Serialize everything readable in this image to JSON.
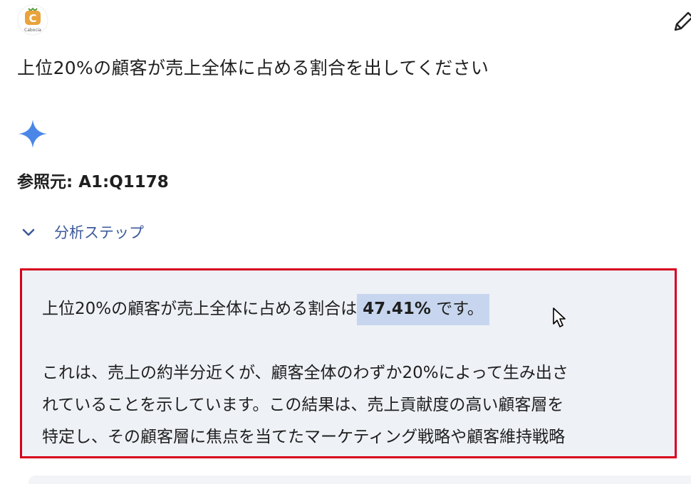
{
  "header": {
    "avatar_name": "Cabocia",
    "avatar_letter": "C",
    "avatar_icon": "cabocia-logo",
    "edit_icon": "pencil-icon"
  },
  "user_query": "上位20%の顧客が売上全体に占める割合を出してください",
  "response": {
    "icon": "sparkle-icon",
    "source_label": "参照元: A1:Q1178",
    "steps_label": "分析ステップ",
    "result": {
      "prefix": "上位20%の顧客が売上全体に占める割合は",
      "value": "47.41%",
      "suffix": "です。"
    },
    "explanation_lines": [
      "これは、売上の約半分近くが、顧客全体のわずか20%によって生み出さ",
      "れていることを示しています。この結果は、売上貢献度の高い顧客層を",
      "特定し、その顧客層に焦点を当てたマーケティング戦略や顧客維持戦略"
    ]
  },
  "colors": {
    "highlight_border": "#d6001c",
    "answer_background": "#eef1f6",
    "selection": "#c7d6ee",
    "sparkle": "#4a86e8",
    "steps_text": "#3c5a99",
    "logo_orange": "#e8a33d"
  }
}
